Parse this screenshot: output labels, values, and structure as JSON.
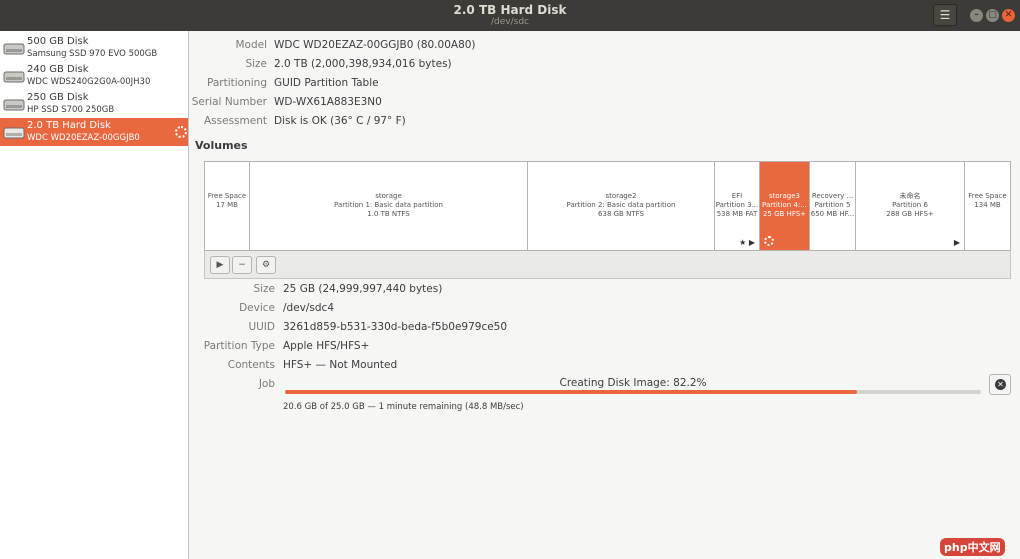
{
  "header": {
    "title": "2.0 TB Hard Disk",
    "subtitle": "/dev/sdc",
    "menu_icon": "hamburger-menu-icon",
    "window_buttons": [
      "minimize",
      "maximize",
      "close"
    ]
  },
  "sidebar": {
    "items": [
      {
        "name": "500 GB Disk",
        "desc": "Samsung SSD 970 EVO 500GB",
        "selected": false
      },
      {
        "name": "240 GB Disk",
        "desc": "WDC WDS240G2G0A-00JH30",
        "selected": false
      },
      {
        "name": "250 GB Disk",
        "desc": "HP SSD S700 250GB",
        "selected": false
      },
      {
        "name": "2.0 TB Hard Disk",
        "desc": "WDC WD20EZAZ-00GGJB0",
        "selected": true
      }
    ]
  },
  "disk_info": [
    {
      "label": "Model",
      "value": "WDC WD20EZAZ-00GGJB0 (80.00A80)"
    },
    {
      "label": "Size",
      "value": "2.0 TB (2,000,398,934,016 bytes)"
    },
    {
      "label": "Partitioning",
      "value": "GUID Partition Table"
    },
    {
      "label": "Serial Number",
      "value": "WD-WX61A883E3N0"
    },
    {
      "label": "Assessment",
      "value": "Disk is OK (36° C / 97° F)"
    }
  ],
  "volumes": {
    "heading": "Volumes",
    "partitions": [
      {
        "lines": [
          "Free Space",
          "17 MB"
        ]
      },
      {
        "lines": [
          "storage",
          "Partition 1: Basic data partition",
          "1.0 TB NTFS"
        ]
      },
      {
        "lines": [
          "storage2",
          "Partition 2: Basic data partition",
          "638 GB NTFS"
        ]
      },
      {
        "lines": [
          "EFI",
          "Partition 3...",
          "538 MB FAT"
        ]
      },
      {
        "lines": [
          "storage3",
          "Partition 4:...",
          "25 GB HFS+"
        ]
      },
      {
        "lines": [
          "Recovery ...",
          "Partition 5",
          "650 MB HF..."
        ]
      },
      {
        "lines": [
          "未命名",
          "Partition 6",
          "288 GB HFS+"
        ]
      },
      {
        "lines": [
          "Free Space",
          "134 MB"
        ]
      }
    ]
  },
  "volume_info": [
    {
      "label": "Size",
      "value": "25 GB (24,999,997,440 bytes)"
    },
    {
      "label": "Device",
      "value": "/dev/sdc4"
    },
    {
      "label": "UUID",
      "value": "3261d859-b531-330d-beda-f5b0e979ce50"
    },
    {
      "label": "Partition Type",
      "value": "Apple HFS/HFS+"
    },
    {
      "label": "Contents",
      "value": "HFS+ — Not Mounted"
    },
    {
      "label": "Job",
      "value": ""
    }
  ],
  "job": {
    "title": "Creating Disk Image: 82.2%",
    "progress": 0.822,
    "detail": "20.6 GB of 25.0 GB — 1 minute remaining (48.8 MB/sec)"
  },
  "watermark": "php中文网",
  "colors": {
    "accent": "#e9683f",
    "header": "#3c3b37"
  }
}
